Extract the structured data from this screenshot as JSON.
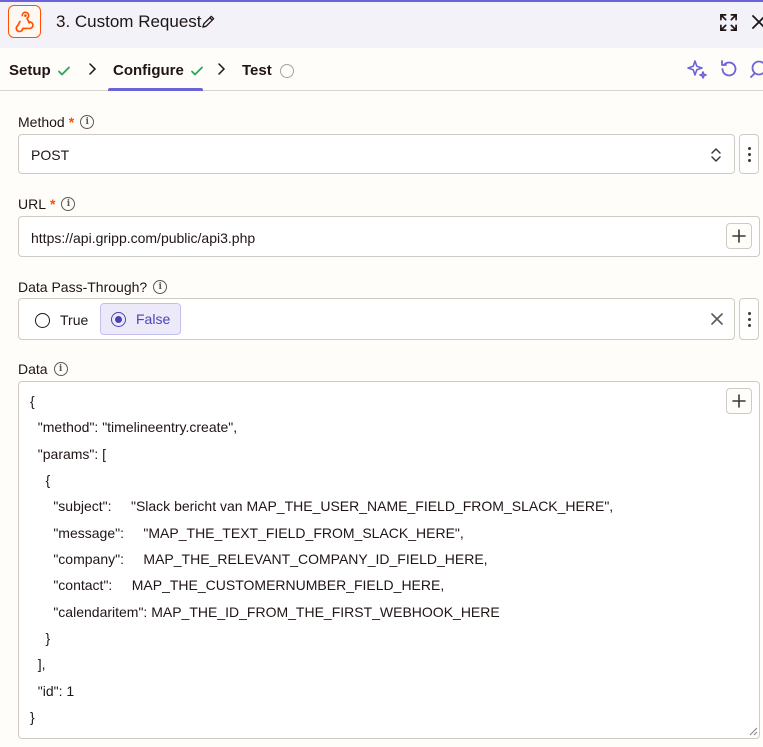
{
  "header": {
    "title": "3. Custom Request",
    "app_icon": "webhook-icon",
    "accent_color": "#ff4f00"
  },
  "tabs": [
    {
      "label": "Setup",
      "status": "complete"
    },
    {
      "label": "Configure",
      "status": "complete",
      "active": true
    },
    {
      "label": "Test",
      "status": "pending"
    }
  ],
  "fields": {
    "method": {
      "label": "Method",
      "required_mark": "*",
      "value": "POST"
    },
    "url": {
      "label": "URL",
      "required_mark": "*",
      "value": "https://api.gripp.com/public/api3.php"
    },
    "pass_through": {
      "label": "Data Pass-Through?",
      "options": [
        "True",
        "False"
      ],
      "selected": "False"
    },
    "data": {
      "label": "Data",
      "lines": [
        "{",
        "  \"method\": \"timelineentry.create\",",
        "  \"params\": [",
        "    {",
        "      \"subject\":     \"Slack bericht van MAP_THE_USER_NAME_FIELD_FROM_SLACK_HERE\",",
        "      \"message\":     \"MAP_THE_TEXT_FIELD_FROM_SLACK_HERE\",",
        "      \"company\":     MAP_THE_RELEVANT_COMPANY_ID_FIELD_HERE,",
        "      \"contact\":     MAP_THE_CUSTOMERNUMBER_FIELD_HERE,",
        "      \"calendaritem\": MAP_THE_ID_FROM_THE_FIRST_WEBHOOK_HERE",
        "    }",
        "  ],",
        "  \"id\": 1",
        "}"
      ]
    }
  },
  "colors": {
    "success": "#26a65b",
    "primary": "#6b63d6"
  }
}
